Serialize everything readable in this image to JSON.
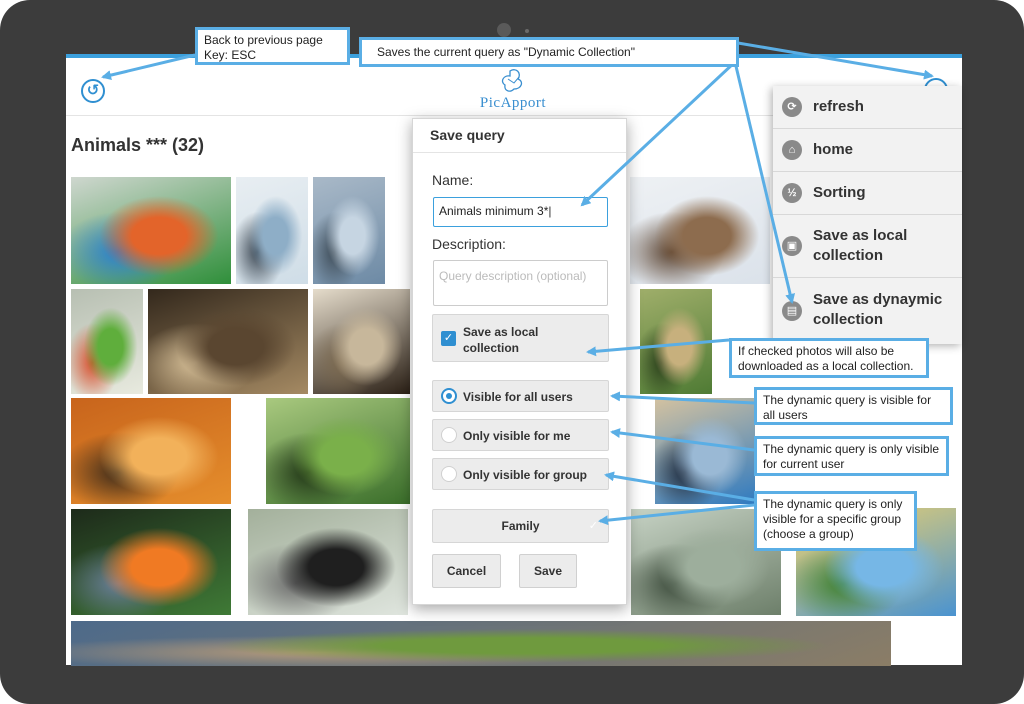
{
  "app": {
    "logo_text": "PicApport",
    "page_title": "Animals *** (32)"
  },
  "photos": [
    {
      "name": "macaw",
      "colors": [
        "#2f8f3a",
        "#e3642a",
        "#2a7fd0",
        "#cfd7cf"
      ]
    },
    {
      "name": "whale-tail",
      "colors": [
        "#cfdde7",
        "#8eaec7",
        "#3a4652",
        "#e8eef2"
      ]
    },
    {
      "name": "whale-spout",
      "colors": [
        "#6d8aa5",
        "#c6d5e2",
        "#3d4b57",
        "#a9b9c8"
      ]
    },
    {
      "name": "sea-lion",
      "colors": [
        "#dbe2ea",
        "#8d6c4e",
        "#5b4330",
        "#eef1f4"
      ]
    },
    {
      "name": "lovebirds",
      "colors": [
        "#e8eadf",
        "#5fae3c",
        "#d84e2c",
        "#b7bfb2"
      ]
    },
    {
      "name": "peacock",
      "colors": [
        "#a58a63",
        "#5a4630",
        "#d9c29a",
        "#33281c"
      ]
    },
    {
      "name": "owl",
      "colors": [
        "#2b2016",
        "#c7b79b",
        "#7c6a50",
        "#e5dccb"
      ]
    },
    {
      "name": "mantis",
      "colors": [
        "#4f7b34",
        "#c7b07d",
        "#2a3f1b",
        "#9fae6a"
      ]
    },
    {
      "name": "birds-sunset",
      "colors": [
        "#e58e2c",
        "#f2b15a",
        "#3a2a1a",
        "#c8641c"
      ]
    },
    {
      "name": "hummingbird",
      "colors": [
        "#3a6e2a",
        "#7ab04a",
        "#1f3315",
        "#a9c97f"
      ]
    },
    {
      "name": "caterpillar",
      "colors": [
        "#2f7ac0",
        "#9ab9d5",
        "#1f2b3d",
        "#d4c2a0"
      ]
    },
    {
      "name": "parakeets",
      "colors": [
        "#4a93d0",
        "#76b7e6",
        "#3d7f2c",
        "#f2d36b"
      ]
    },
    {
      "name": "parrot-orange",
      "colors": [
        "#3f7a36",
        "#f07a23",
        "#6b7f9b",
        "#1d2a1a"
      ]
    },
    {
      "name": "black-bird",
      "colors": [
        "#dfe5de",
        "#1f1f1f",
        "#6b6b6b",
        "#a3b09b"
      ]
    },
    {
      "name": "crocodiles",
      "colors": [
        "#6d7f6a",
        "#9dae9c",
        "#3b4a3a",
        "#c6d2c4"
      ]
    },
    {
      "name": "bottom-row",
      "colors": [
        "#8b7d66",
        "#6f9a3e",
        "#b59a7a",
        "#4d6a8a"
      ]
    }
  ],
  "dialog": {
    "title": "Save query",
    "name_label": "Name:",
    "name_value": "Animals minimum 3*",
    "description_label": "Description:",
    "description_placeholder": "Query description (optional)",
    "save_local_label": "Save as local collection",
    "save_local_checked": true,
    "visibility_options": [
      {
        "label": "Visible for all users",
        "selected": true
      },
      {
        "label": "Only visible for me",
        "selected": false
      },
      {
        "label": "Only visible for group",
        "selected": false
      }
    ],
    "group_value": "Family",
    "cancel_label": "Cancel",
    "save_label": "Save"
  },
  "menu": {
    "items": [
      {
        "label": "refresh",
        "icon": "refresh-icon"
      },
      {
        "label": "home",
        "icon": "home-icon"
      },
      {
        "label": "Sorting",
        "icon": "sort-icon"
      },
      {
        "label": "Save as local collection",
        "icon": "briefcase-icon"
      },
      {
        "label": "Save as dynaymic collection",
        "icon": "disk-icon"
      }
    ]
  },
  "callouts": {
    "back": "Back to previous page\nKey: ESC",
    "saves": "Saves the current query as \"Dynamic Collection\"",
    "local": "If checked photos will also be downloaded as a local collection.",
    "all_users": "The dynamic query is visible for all users",
    "current_user": "The dynamic query is only visible for current user",
    "group": "The dynamic query is only visible for a specific group (choose a group)"
  },
  "colors": {
    "accent": "#2f8fd1",
    "callout_border": "#5aaee5",
    "frame": "#3c3c3c"
  }
}
